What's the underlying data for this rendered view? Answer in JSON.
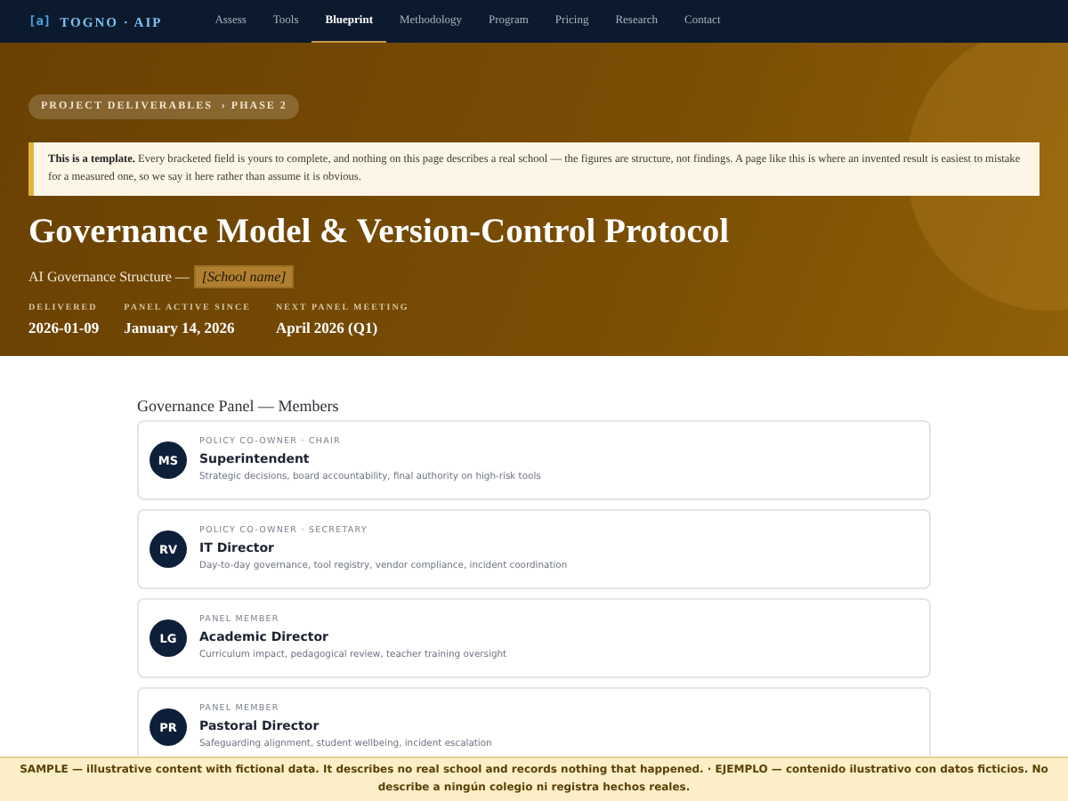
{
  "nav": {
    "logo_mark": "[a]",
    "logo_text": "TOGNO · AIP",
    "items": [
      {
        "label": "Assess",
        "selected": false
      },
      {
        "label": "Tools",
        "selected": false
      },
      {
        "label": "Blueprint",
        "selected": true
      },
      {
        "label": "Methodology",
        "selected": false
      },
      {
        "label": "Program",
        "selected": false
      },
      {
        "label": "Pricing",
        "selected": false
      },
      {
        "label": "Research",
        "selected": false
      },
      {
        "label": "Contact",
        "selected": false
      }
    ]
  },
  "hero": {
    "breadcrumb": "PROJECT DELIVERABLES  › PHASE 2",
    "notice": "**This is a template.** Every bracketed field is yours to complete, and nothing on this page describes a real school — the figures are structure, not findings. A page like this is where an invented result is easiest to mistake for a measured one, so we say it here rather than assume it is obvious.",
    "title": "Governance Model & Version-Control Protocol",
    "subtitle": "AI Governance Structure —",
    "subtitle_placeholder": "[School name]",
    "meta": [
      {
        "label": "DELIVERED",
        "value": "2026-01-09"
      },
      {
        "label": "PANEL ACTIVE SINCE",
        "value": "January 14, 2026"
      },
      {
        "label": "NEXT PANEL MEETING",
        "value": "April 2026 (Q1)"
      }
    ]
  },
  "panel": {
    "heading": "Governance Panel — Members",
    "members": [
      {
        "initials": "MS",
        "role": "POLICY CO-OWNER · CHAIR",
        "name": "Superintendent",
        "duties": "Strategic decisions, board accountability, final authority on high-risk tools"
      },
      {
        "initials": "RV",
        "role": "POLICY CO-OWNER · SECRETARY",
        "name": "IT Director",
        "duties": "Day-to-day governance, tool registry, vendor compliance, incident coordination"
      },
      {
        "initials": "LG",
        "role": "PANEL MEMBER",
        "name": "Academic Director",
        "duties": "Curriculum impact, pedagogical review, teacher training oversight"
      },
      {
        "initials": "PR",
        "role": "PANEL MEMBER",
        "name": "Pastoral Director",
        "duties": "Safeguarding alignment, student wellbeing, incident escalation"
      }
    ]
  },
  "sample_banner": "SAMPLE — illustrative content with fictional data. It describes no real school and records nothing that happened. · EJEMPLO — contenido ilustrativo con datos ficticios. No describe a ningún colegio ni registra hechos reales."
}
